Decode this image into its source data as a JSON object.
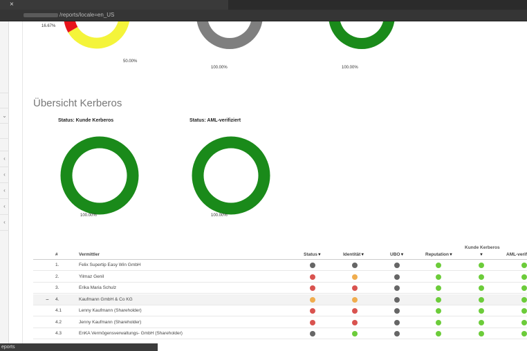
{
  "browser": {
    "url": "/reports/locale=en_US",
    "tab_close": "×"
  },
  "colors": {
    "green": "#1a8a1a",
    "yellow": "#f4f43a",
    "red": "#e8141b",
    "gray": "#7f7f7f",
    "dot_gray": "#666666",
    "dot_red": "#d9534f",
    "dot_orange": "#f0ad4e",
    "dot_green": "#6ccc3a"
  },
  "top_charts": [
    {
      "labels": [
        "16.67%",
        "50.00%"
      ]
    },
    {
      "labels": [
        "100.00%"
      ]
    },
    {
      "labels": [
        "100.00%"
      ]
    }
  ],
  "section": {
    "title": "Übersicht Kerberos"
  },
  "kerberos_charts": [
    {
      "title": "Status: Kunde Kerberos",
      "label": "100.00%"
    },
    {
      "title": "Status: AML-verifiziert",
      "label": "100.00%"
    }
  ],
  "table": {
    "group_header": "Kunde Kerberos",
    "headers": {
      "num": "#",
      "vermittler": "Vermittler",
      "status": "Status",
      "identitaet": "Identität",
      "ubo": "UBO",
      "reputation": "Reputation",
      "kunde": "",
      "aml": "AML-verif"
    },
    "filter_icon": "▼",
    "rows": [
      {
        "num": "1.",
        "name": "Felix Supertip Easy Win GmbH",
        "dots": [
          "dot_gray",
          "dot_gray",
          "dot_gray",
          "dot_green",
          "dot_green",
          "dot_green"
        ]
      },
      {
        "num": "2.",
        "name": "Yilmaz Genil",
        "dots": [
          "dot_red",
          "dot_orange",
          "dot_gray",
          "dot_green",
          "dot_green",
          "dot_green"
        ]
      },
      {
        "num": "3.",
        "name": "Erika Maria Schulz",
        "dots": [
          "dot_red",
          "dot_red",
          "dot_gray",
          "dot_green",
          "dot_green",
          "dot_green"
        ]
      },
      {
        "num": "4.",
        "name": "Kaufmann GmbH & Co KG",
        "dots": [
          "dot_orange",
          "dot_orange",
          "dot_gray",
          "dot_green",
          "dot_green",
          "dot_green"
        ],
        "expanded": "−"
      },
      {
        "num": "4.1",
        "name": "Lenny Kaufmann (Shareholder)",
        "dots": [
          "dot_red",
          "dot_red",
          "dot_gray",
          "dot_green",
          "dot_green",
          "dot_green"
        ]
      },
      {
        "num": "4.2",
        "name": "Jenny Kaufmann (Shareholder)",
        "dots": [
          "dot_red",
          "dot_red",
          "dot_gray",
          "dot_green",
          "dot_green",
          "dot_green"
        ]
      },
      {
        "num": "4.3",
        "name": "EnKA Vermögensverwaltungs- GmbH (Shareholder)",
        "dots": [
          "dot_gray",
          "dot_green",
          "dot_gray",
          "dot_green",
          "dot_green",
          "dot_green"
        ]
      }
    ]
  },
  "statusbar": {
    "text": "eports"
  }
}
